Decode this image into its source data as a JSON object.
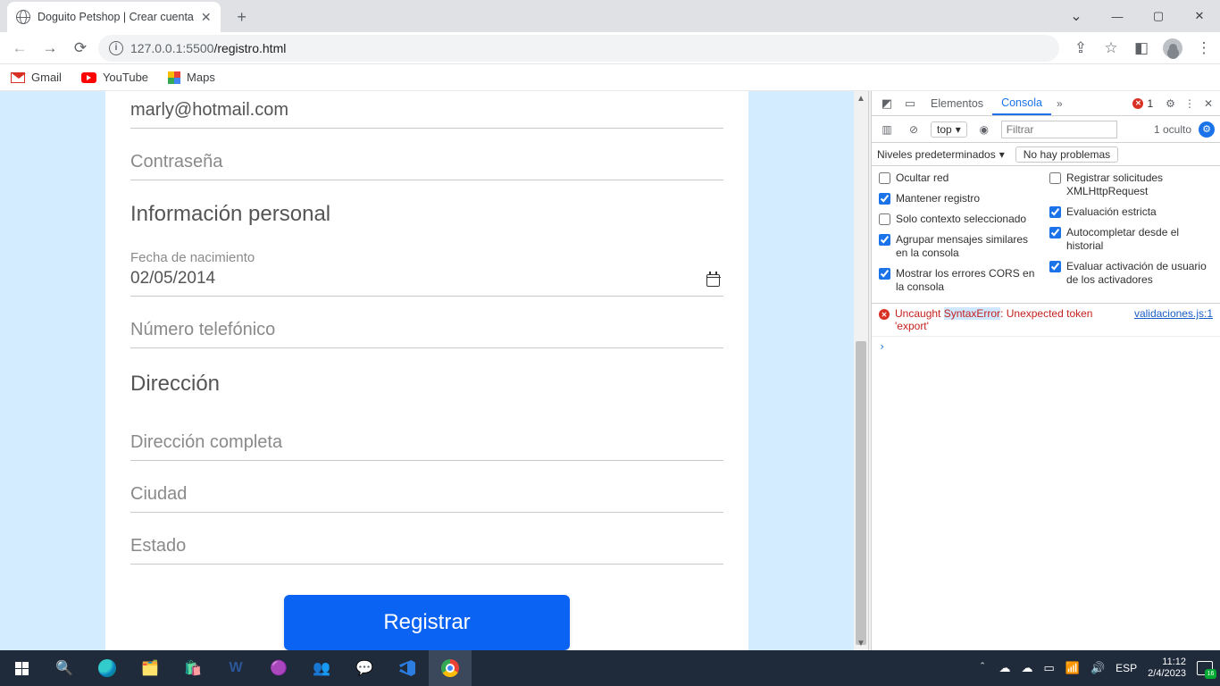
{
  "browser": {
    "tab_title": "Doguito Petshop | Crear cuenta",
    "url_host": "127.0.0.1",
    "url_port": ":5500",
    "url_path": "/registro.html",
    "bookmarks": {
      "gmail": "Gmail",
      "youtube": "YouTube",
      "maps": "Maps"
    }
  },
  "form": {
    "email_value": "marly@hotmail.com",
    "password_placeholder": "Contraseña",
    "section_personal": "Información personal",
    "birth_label": "Fecha de nacimiento",
    "birth_value": "02/05/2014",
    "phone_placeholder": "Número telefónico",
    "section_address": "Dirección",
    "address_placeholder": "Dirección completa",
    "city_placeholder": "Ciudad",
    "state_placeholder": "Estado",
    "submit_label": "Registrar"
  },
  "devtools": {
    "tabs": {
      "elements": "Elementos",
      "console": "Consola"
    },
    "error_count": "1",
    "context_selector": "top",
    "filter_placeholder": "Filtrar",
    "hidden_label": "1 oculto",
    "levels_label": "Niveles predeterminados",
    "no_problems": "No hay problemas",
    "opts": {
      "hide_network": "Ocultar red",
      "xhr": "Registrar solicitudes XMLHttpRequest",
      "preserve": "Mantener registro",
      "strict_eval": "Evaluación estricta",
      "selected_ctx": "Solo contexto seleccionado",
      "autocomplete": "Autocompletar desde el historial",
      "group": "Agrupar mensajes similares en la consola",
      "user_activation": "Evaluar activación de usuario de los activadores",
      "cors": "Mostrar los errores CORS en la consola"
    },
    "error": {
      "pre": "Uncaught ",
      "type": "SyntaxError",
      "post": ": Unexpected token 'export'",
      "source": "validaciones.js:1"
    }
  },
  "system": {
    "lang": "ESP",
    "time": "11:12",
    "date": "2/4/2023"
  }
}
